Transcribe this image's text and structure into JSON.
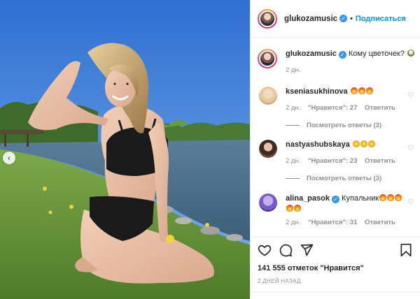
{
  "post": {
    "author": "glukozamusic",
    "follow_label": "Подписаться",
    "separator": "•"
  },
  "caption": {
    "username": "glukozamusic",
    "text": "Кому цветочек?",
    "time": "2 дн."
  },
  "comments": [
    {
      "username": "kseniasukhinova",
      "text": "",
      "emoji": [
        "fire",
        "fire",
        "fire"
      ],
      "time": "2 дн.",
      "likes_label": "\"Нравится\": 27",
      "reply_label": "Ответить",
      "view_replies_label": "Посмотреть ответы (3)"
    },
    {
      "username": "nastyashubskaya",
      "text": "",
      "emoji": [
        "star",
        "star",
        "star"
      ],
      "time": "2 дн.",
      "likes_label": "\"Нравится\": 23",
      "reply_label": "Ответить",
      "view_replies_label": "Посмотреть ответы (3)"
    },
    {
      "username": "alina_pasok",
      "text": "Купальник",
      "emoji": [
        "fire",
        "fire",
        "fire",
        "fire",
        "fire"
      ],
      "time": "2 дн.",
      "likes_label": "\"Нравится\": 31",
      "reply_label": "Ответить"
    }
  ],
  "likes_count": "141 555 отметок \"Нравится\"",
  "post_date": "2 ДНЕЙ НАЗАД",
  "colors": {
    "accent": "#0095f6",
    "verified": "#3897f0",
    "muted": "#8e8e8e"
  },
  "icons": [
    "verified-icon",
    "heart-icon",
    "comment-icon",
    "share-icon",
    "bookmark-icon",
    "chevron-left-icon"
  ]
}
